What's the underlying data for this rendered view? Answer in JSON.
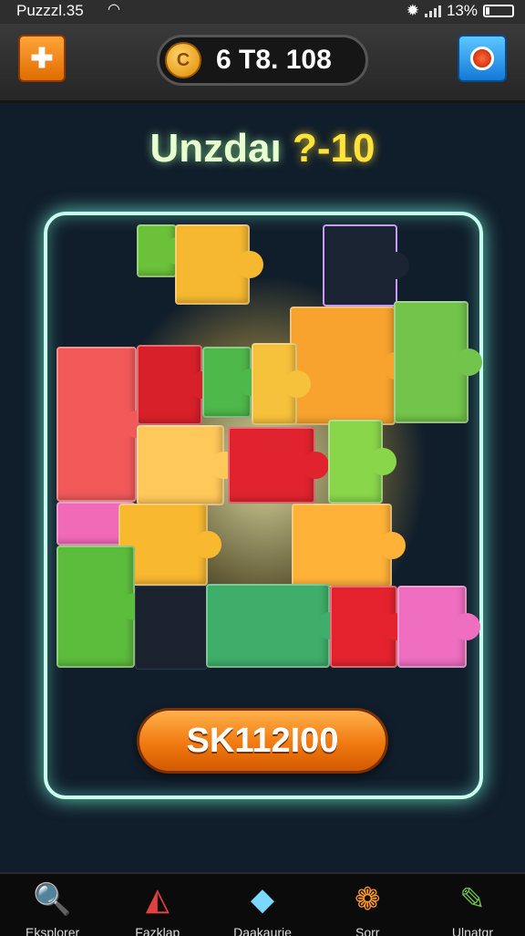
{
  "status_bar": {
    "time": "Puzzzl.35",
    "battery": "13%",
    "battery_level": 0.13
  },
  "top_bar": {
    "coins": "6 Т8. 108",
    "menu_icon": "puzzle-piece-icon",
    "search_icon": "magnifier-icon"
  },
  "level": {
    "title_part1": "Unzdaı",
    "title_part2": "?-10"
  },
  "actions": {
    "skip_label": "SK112I00"
  },
  "bottom_nav": {
    "items": [
      {
        "label": "Eksplorer",
        "icon": "magnifier-icon"
      },
      {
        "label": "Fazklap",
        "icon": "triangle-prism-icon"
      },
      {
        "label": "Daakaurie",
        "icon": "gem-icon"
      },
      {
        "label": "Sorr",
        "icon": "color-dots-icon"
      },
      {
        "label": "Ulnatgr",
        "icon": "clipboard-leaf-icon"
      }
    ]
  },
  "colors": {
    "frame_glow": "#c8fff0",
    "button_orange": "#f07a10",
    "title_green": "#e8ffd0",
    "title_yellow": "#ffe23a"
  }
}
